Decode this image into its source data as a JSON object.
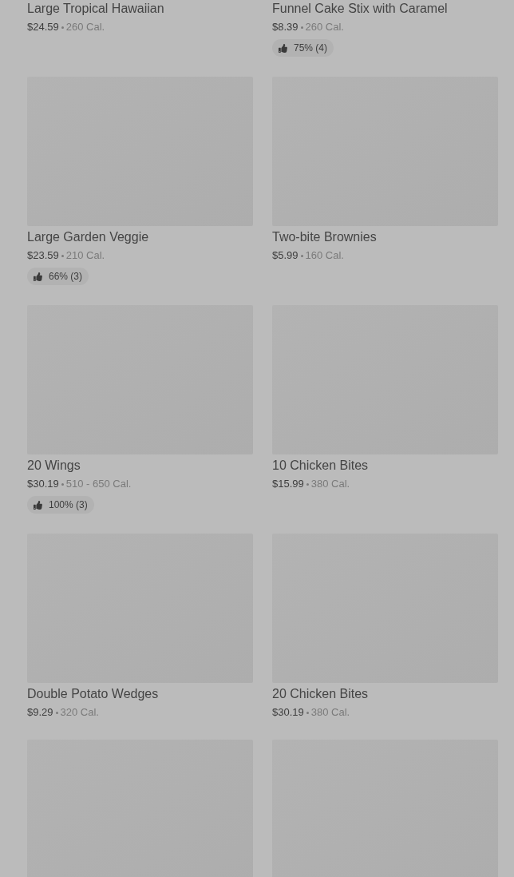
{
  "items": [
    {
      "image": false,
      "name": "Large Tropical Hawaiian",
      "price": "$24.59",
      "calories": "260 Cal."
    },
    {
      "image": false,
      "name": "Funnel Cake Stix with Caramel",
      "price": "$8.39",
      "calories": "260 Cal.",
      "rating": "75% (4)"
    },
    {
      "image": true,
      "name": "Large Garden Veggie",
      "price": "$23.59",
      "calories": "210 Cal.",
      "rating": "66% (3)"
    },
    {
      "image": true,
      "name": "Two-bite Brownies",
      "price": "$5.99",
      "calories": "160 Cal."
    },
    {
      "image": true,
      "name": "20 Wings",
      "price": "$30.19",
      "calories": "510 - 650 Cal.",
      "rating": "100% (3)"
    },
    {
      "image": true,
      "name": "10 Chicken Bites",
      "price": "$15.99",
      "calories": "380 Cal."
    },
    {
      "image": true,
      "name": "Double Potato Wedges",
      "price": "$9.29",
      "calories": "320 Cal."
    },
    {
      "image": true,
      "name": "20 Chicken Bites",
      "price": "$30.19",
      "calories": "380 Cal."
    },
    {
      "image": true
    },
    {
      "image": true
    }
  ]
}
